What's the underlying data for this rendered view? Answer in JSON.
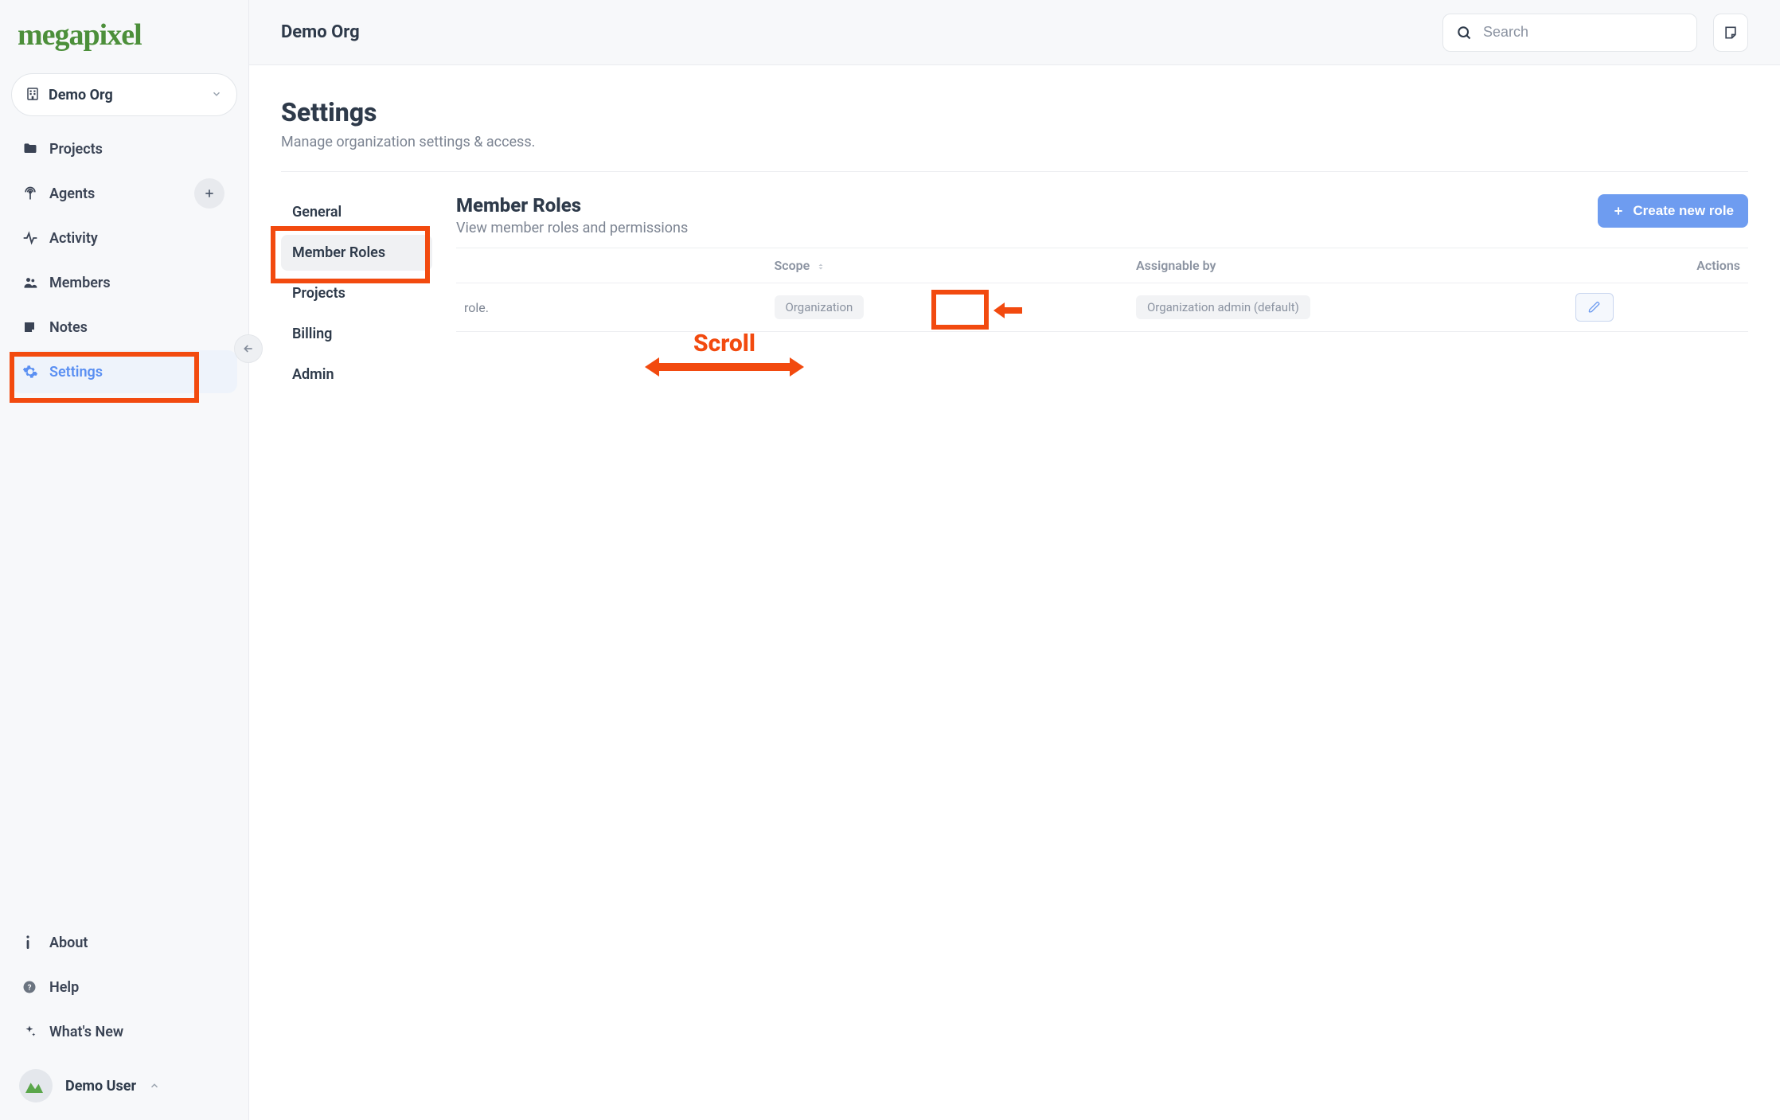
{
  "brand": "megapixel",
  "org_selector": {
    "name": "Demo Org"
  },
  "sidebar": {
    "items": [
      {
        "label": "Projects"
      },
      {
        "label": "Agents"
      },
      {
        "label": "Activity"
      },
      {
        "label": "Members"
      },
      {
        "label": "Notes"
      },
      {
        "label": "Settings"
      }
    ],
    "bottom": [
      {
        "label": "About"
      },
      {
        "label": "Help"
      },
      {
        "label": "What's New"
      }
    ]
  },
  "user": {
    "name": "Demo User"
  },
  "topbar": {
    "title": "Demo Org",
    "search_placeholder": "Search"
  },
  "page": {
    "title": "Settings",
    "subtitle": "Manage organization settings & access."
  },
  "settings_tabs": [
    {
      "label": "General"
    },
    {
      "label": "Member Roles"
    },
    {
      "label": "Projects"
    },
    {
      "label": "Billing"
    },
    {
      "label": "Admin"
    }
  ],
  "member_roles": {
    "title": "Member Roles",
    "subtitle": "View member roles and permissions",
    "create_button": "Create new role",
    "columns": {
      "scope": "Scope",
      "assignable_by": "Assignable by",
      "actions": "Actions"
    },
    "rows": [
      {
        "name": "role.",
        "scope": "Organization",
        "assignable_by": "Organization admin (default)"
      }
    ]
  },
  "annotations": {
    "scroll_label": "Scroll"
  }
}
